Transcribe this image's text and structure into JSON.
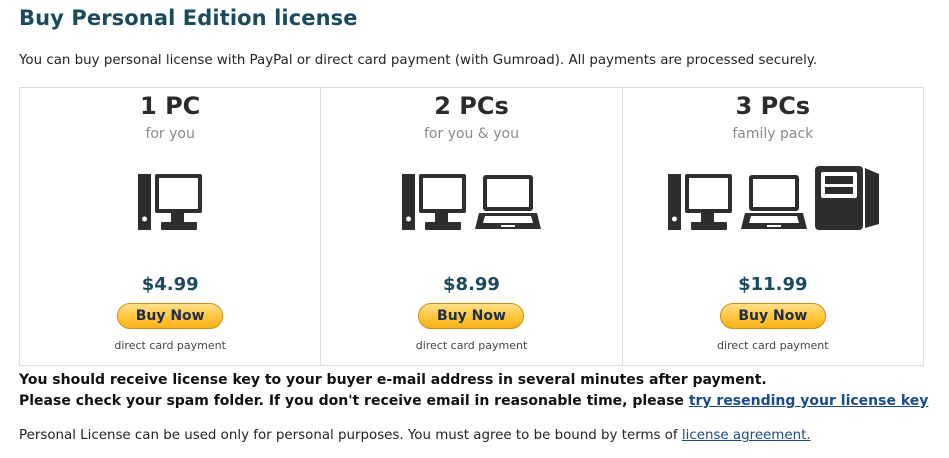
{
  "page": {
    "title": "Buy Personal Edition license",
    "intro": "You can buy personal license with PayPal or direct card payment (with Gumroad). All payments are processed securely."
  },
  "colors": {
    "heading": "#1a4a5e",
    "button": "#ffc439",
    "link": "#1a4a8a",
    "icon": "#2e2e2e"
  },
  "plans": [
    {
      "title": "1 PC",
      "subtitle": "for you",
      "icons": [
        "desktop-icon"
      ],
      "price": "$4.99",
      "button": "Buy Now",
      "note": "direct card payment"
    },
    {
      "title": "2 PCs",
      "subtitle": "for you & you",
      "icons": [
        "desktop-icon",
        "laptop-icon"
      ],
      "price": "$8.99",
      "button": "Buy Now",
      "note": "direct card payment"
    },
    {
      "title": "3 PCs",
      "subtitle": "family pack",
      "icons": [
        "desktop-icon",
        "laptop-icon",
        "tower-icon"
      ],
      "price": "$11.99",
      "button": "Buy Now",
      "note": "direct card payment"
    }
  ],
  "notice": {
    "line1": "You should receive license key to your buyer e-mail address in several minutes after payment.",
    "line2": "Please check your spam folder. If you don't receive email in reasonable time, please ",
    "link": "try resending your license key"
  },
  "footer": {
    "text": "Personal License can be used only for personal purposes. You must agree to be bound by terms of ",
    "link": "license agreement."
  }
}
